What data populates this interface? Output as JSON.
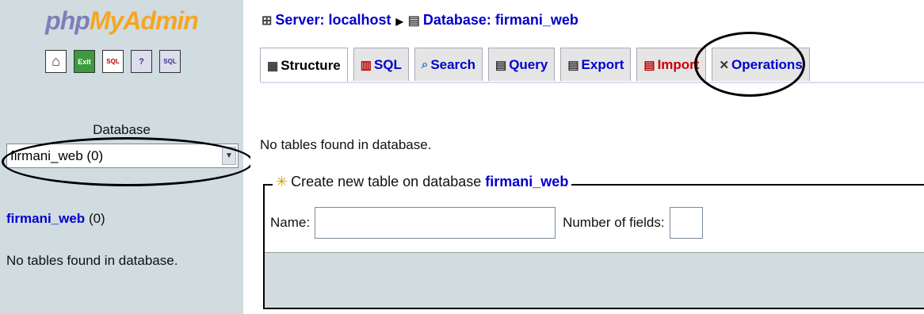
{
  "sidebar": {
    "logo_part1": "php",
    "logo_part2": "MyAdmin",
    "icons": [
      {
        "name": "home-icon",
        "glyph": "⌂"
      },
      {
        "name": "exit-icon",
        "glyph": "Exit"
      },
      {
        "name": "sql-query-icon",
        "glyph": "SQL"
      },
      {
        "name": "help-icon",
        "glyph": "?"
      },
      {
        "name": "sql-docs-icon",
        "glyph": "SQL"
      }
    ],
    "database_label": "Database",
    "database_select_value": "firmani_web (0)",
    "db_link_name": "firmani_web",
    "db_link_count": "(0)",
    "empty_message": "No tables found in database."
  },
  "breadcrumb": {
    "server": "Server: localhost",
    "separator": "▶",
    "database": "Database: firmani_web"
  },
  "tabs": [
    {
      "label": "Structure",
      "icon": "structure-icon"
    },
    {
      "label": "SQL",
      "icon": "sql-icon"
    },
    {
      "label": "Search",
      "icon": "search-icon"
    },
    {
      "label": "Query",
      "icon": "query-icon"
    },
    {
      "label": "Export",
      "icon": "export-icon"
    },
    {
      "label": "Import",
      "icon": "import-icon"
    },
    {
      "label": "Operations",
      "icon": "operations-icon"
    }
  ],
  "main": {
    "notice": "No tables found in database.",
    "create_legend_text": "Create new table on database",
    "create_legend_db": "firmani_web",
    "name_label": "Name:",
    "fields_label": "Number of fields:",
    "name_value": "",
    "fields_value": ""
  },
  "colors": {
    "sidebar_bg": "#D0DCE0",
    "link": "#0000cc",
    "import_tab": "#cc0000"
  }
}
